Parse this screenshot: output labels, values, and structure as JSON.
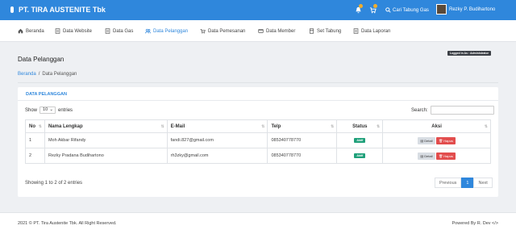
{
  "header": {
    "brand": "PT. TIRA AUSTENITE Tbk",
    "search_label": "Cari Tabung Gas",
    "user_name": "Rezky P. Budihartono"
  },
  "menu": [
    {
      "label": "Beranda",
      "icon": "home-icon"
    },
    {
      "label": "Data Website",
      "icon": "document-icon"
    },
    {
      "label": "Data Gas",
      "icon": "document-icon"
    },
    {
      "label": "Data Pelanggan",
      "icon": "users-icon"
    },
    {
      "label": "Data Pemesanan",
      "icon": "cart-icon"
    },
    {
      "label": "Data Member",
      "icon": "card-icon"
    },
    {
      "label": "Set Tabung",
      "icon": "cylinder-icon"
    },
    {
      "label": "Data Laporan",
      "icon": "document-icon"
    }
  ],
  "page": {
    "title": "Data Pelanggan",
    "logged_in": "Logged in As : Administrator",
    "breadcrumb_home": "Beranda",
    "breadcrumb_sep": "/",
    "breadcrumb_current": "Data Pelanggan"
  },
  "card": {
    "title": "DATA PELANGGAN",
    "show_label": "Show",
    "show_value": "10",
    "entries_label": "entries",
    "search_label": "Search:"
  },
  "table": {
    "headers": [
      "No",
      "Nama Lengkap",
      "E-Mail",
      "Telp",
      "Status",
      "Aksi"
    ],
    "rows": [
      {
        "no": "1",
        "name": "Moh Akbar Rifandy",
        "email": "fandi.827@gmail.com",
        "telp": "085340778770",
        "status": "Aktif"
      },
      {
        "no": "2",
        "name": "Rezky Pradana Budihartono",
        "email": "rh3zky@gmail.com",
        "telp": "085340778770",
        "status": "Aktif"
      }
    ],
    "detail_label": "Detail",
    "hapus_label": "Hapus"
  },
  "footer_info": "Showing 1 to 2 of 2 entries",
  "pagination": {
    "previous": "Previous",
    "current": "1",
    "next": "Next"
  },
  "footer": {
    "left": "2021 © PT. Tira Austenite Tbk. All Right Reserved.",
    "right": "Powered By R. Dev </>"
  },
  "colors": {
    "primary": "#2f87dc",
    "badge": "#1fa07a",
    "danger": "#e24d4d"
  }
}
